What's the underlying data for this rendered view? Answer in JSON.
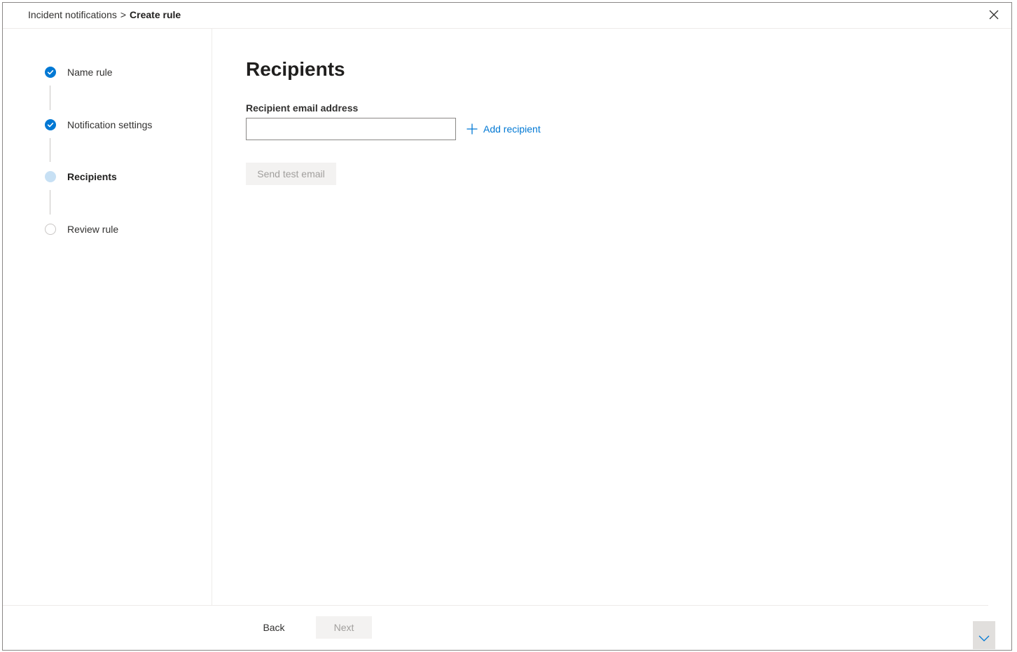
{
  "breadcrumb": {
    "parent": "Incident notifications",
    "separator": ">",
    "current": "Create rule"
  },
  "steps": [
    {
      "label": "Name rule",
      "state": "completed"
    },
    {
      "label": "Notification settings",
      "state": "completed"
    },
    {
      "label": "Recipients",
      "state": "current"
    },
    {
      "label": "Review rule",
      "state": "not-started"
    }
  ],
  "main": {
    "title": "Recipients",
    "email_label": "Recipient email address",
    "email_value": "",
    "email_placeholder": "",
    "add_recipient_label": "Add recipient",
    "send_test_label": "Send test email"
  },
  "footer": {
    "back_label": "Back",
    "next_label": "Next"
  },
  "colors": {
    "accent": "#0078d4",
    "current_step": "#c7e0f4",
    "disabled_bg": "#f3f2f1",
    "disabled_text": "#a19f9d"
  },
  "icons": {
    "close": "close-icon",
    "check": "checkmark-icon",
    "add": "plus-icon",
    "scroll": "chevron-down-icon"
  }
}
